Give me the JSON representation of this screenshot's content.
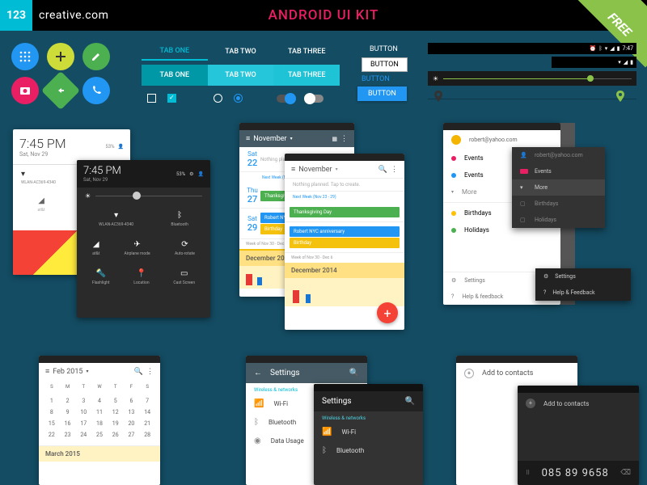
{
  "header": {
    "logo": "123",
    "brand": "creative.com",
    "title": "ANDROID UI KIT",
    "ribbon": "FREE"
  },
  "icons": [
    "dialpad",
    "add",
    "edit",
    "camera",
    "directions",
    "call"
  ],
  "tabs": {
    "labels": [
      "TAB ONE",
      "TAB TWO",
      "TAB THREE"
    ]
  },
  "buttons": {
    "outline": "BUTTON",
    "white": "BUTTON",
    "link": "BUTTON",
    "solid": "BUTTON"
  },
  "statusbar": {
    "time": "7:47"
  },
  "notif": {
    "time": "7:45 PM",
    "date": "Sat, Nov 29",
    "battery": "53%"
  },
  "notif2": {
    "time": "7:45 PM",
    "date": "Sat, Nov 29",
    "battery": "53%"
  },
  "qs": {
    "wifi": "WLAN-AC369-4340",
    "bt": "Bluetooth",
    "flash": "Flashlight",
    "signal": "at&t",
    "airplane": "Airplane mode",
    "rotate": "Auto-rotate",
    "flash2": "Flashlight",
    "loc": "Location",
    "cast": "Cast Screen"
  },
  "calendar": {
    "month": "November",
    "dates": [
      {
        "wd": "Sat",
        "n": "22",
        "ev": "Nothing planned. Tap to create.",
        "color": "transparent"
      },
      {
        "wd": "",
        "n": "",
        "ev": "Next Week (Nov 23 - 29)",
        "color": "transparent"
      },
      {
        "wd": "Thu",
        "n": "27",
        "ev": "Thanksgiving Day",
        "color": "#4caf50"
      },
      {
        "wd": "Sat",
        "n": "29",
        "ev": "Robert NYC anniversary",
        "color": "#2196f3"
      },
      {
        "wd": "",
        "n": "",
        "ev": "Birthday",
        "color": "#f4c20d"
      },
      {
        "wd": "",
        "n": "",
        "ev": "Week of Nov 30 - Dec 6",
        "color": "transparent"
      }
    ],
    "footer": "December 2014"
  },
  "drawer": {
    "email": "robert@yahoo.com",
    "items": [
      {
        "label": "Events",
        "color": "#e91e63"
      },
      {
        "label": "Events",
        "color": "#2196f3"
      }
    ],
    "more": "More",
    "extra": [
      {
        "label": "Birthdays",
        "color": "#ffc107"
      },
      {
        "label": "Holidays",
        "color": "#4caf50"
      }
    ],
    "bottom": [
      {
        "ico": "⚙",
        "label": "Settings"
      },
      {
        "ico": "?",
        "label": "Help & feedback"
      }
    ]
  },
  "menu": {
    "items": [
      "robert@yahoo.com",
      "Events",
      "More",
      "Birthdays",
      "Holidays"
    ],
    "bottom": [
      "Settings",
      "Help & Feedback"
    ]
  },
  "monthCal": {
    "title": "Feb 2015",
    "days": [
      "S",
      "M",
      "T",
      "W",
      "T",
      "F",
      "S"
    ],
    "cells": [
      "1",
      "2",
      "3",
      "4",
      "5",
      "6",
      "7",
      "8",
      "9",
      "10",
      "11",
      "12",
      "13",
      "14",
      "15",
      "16",
      "17",
      "18",
      "19",
      "20",
      "21",
      "22",
      "23",
      "24",
      "25",
      "26",
      "27",
      "28"
    ],
    "next": "March 2015"
  },
  "settings": {
    "title": "Settings",
    "cat": "Wireless & networks",
    "items": [
      {
        "ico": "📶",
        "label": "Wi-Fi"
      },
      {
        "ico": "ᛒ",
        "label": "Bluetooth"
      },
      {
        "ico": "◉",
        "label": "Data Usage"
      }
    ]
  },
  "settings2": {
    "title": "Settings",
    "cat": "Wireless & networks",
    "items": [
      {
        "ico": "📶",
        "label": "Wi-Fi"
      },
      {
        "ico": "ᛒ",
        "label": "Bluetooth"
      }
    ]
  },
  "contacts": {
    "title": "Add to contacts",
    "title2": "Add to contacts",
    "number": "085 89 9658"
  }
}
